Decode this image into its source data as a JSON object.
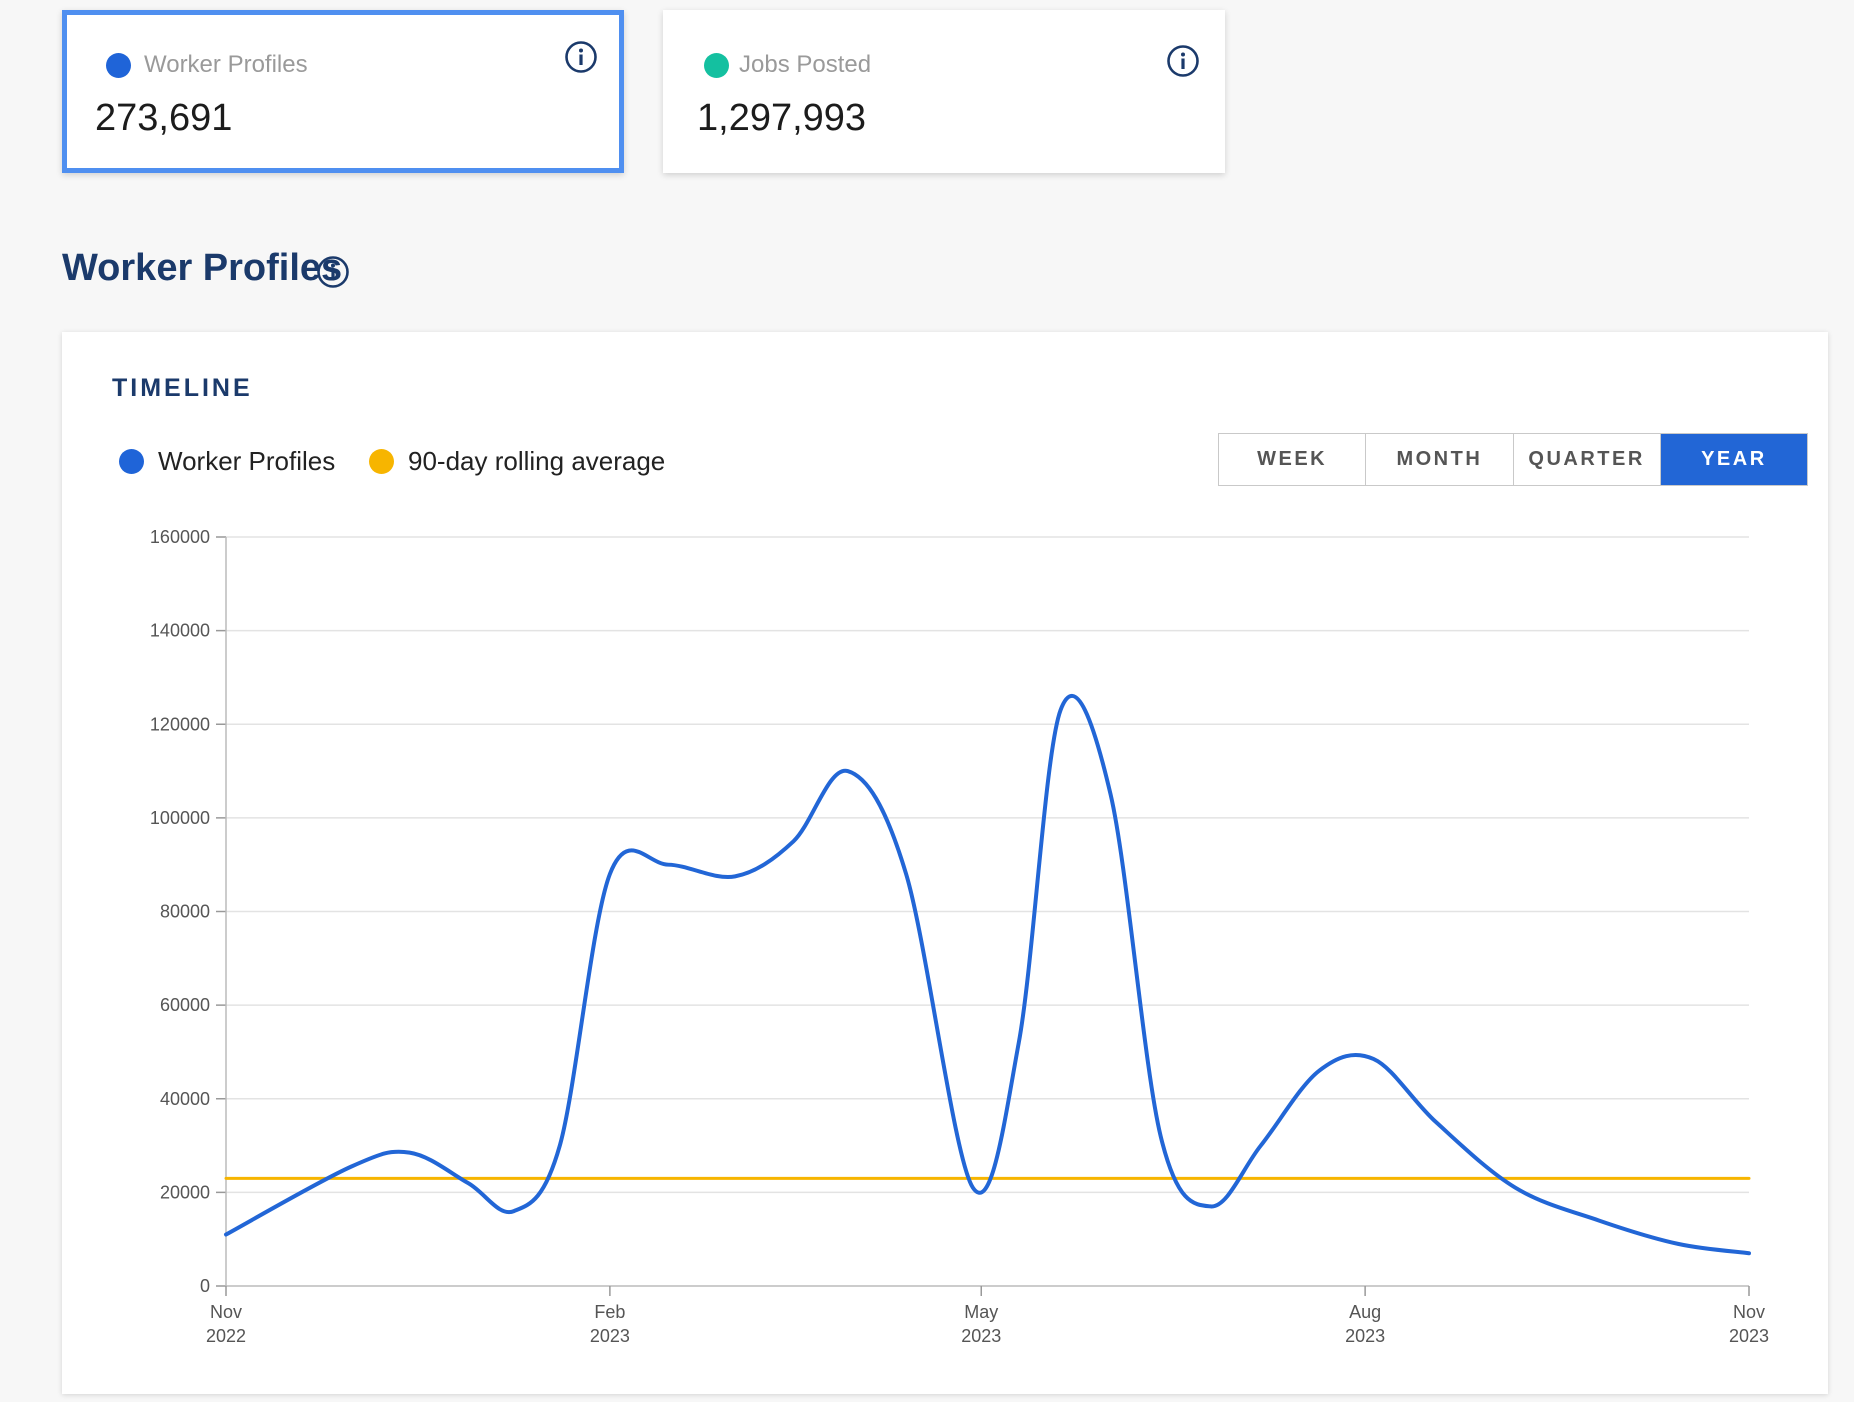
{
  "colors": {
    "accent_blue": "#2266d6",
    "worker_dot": "#1f64d8",
    "jobs_dot": "#14c0a0",
    "rolling_avg": "#f7b500",
    "selected_border": "#4f8ff0",
    "heading": "#1b3a6b"
  },
  "stat_cards": [
    {
      "label": "Worker Profiles",
      "value": "273,691",
      "selected": true,
      "icon": "info-icon"
    },
    {
      "label": "Jobs Posted",
      "value": "1,297,993",
      "selected": false,
      "icon": "info-icon"
    }
  ],
  "section": {
    "title": "Worker Profiles",
    "icon": "info-icon"
  },
  "timeline": {
    "title": "TIMELINE",
    "legend": [
      {
        "label": "Worker Profiles",
        "color": "#1f64d8"
      },
      {
        "label": "90-day rolling average",
        "color": "#f7b500"
      }
    ],
    "ranges": [
      "WEEK",
      "MONTH",
      "QUARTER",
      "YEAR"
    ],
    "active_range": "YEAR"
  },
  "chart_data": {
    "type": "line",
    "title": "",
    "xlabel": "",
    "ylabel": "",
    "x_ticks": [
      {
        "date": "2022-11",
        "line1": "Nov",
        "line2": "2022"
      },
      {
        "date": "2023-02",
        "line1": "Feb",
        "line2": "2023"
      },
      {
        "date": "2023-05",
        "line1": "May",
        "line2": "2023"
      },
      {
        "date": "2023-08",
        "line1": "Aug",
        "line2": "2023"
      },
      {
        "date": "2023-11",
        "line1": "Nov",
        "line2": "2023"
      }
    ],
    "xlim": [
      "2022-11",
      "2023-11"
    ],
    "ylim": [
      0,
      160000
    ],
    "y_ticks": [
      0,
      20000,
      40000,
      60000,
      80000,
      100000,
      120000,
      140000,
      160000
    ],
    "grid": true,
    "legend_position": "top-left",
    "series": [
      {
        "name": "Worker Profiles",
        "color": "#2266d6",
        "points": [
          {
            "x": "2022-11",
            "y": 11000
          },
          {
            "x": "2022-12-01",
            "y": 25500
          },
          {
            "x": "2022-12-15",
            "y": 28500
          },
          {
            "x": "2022-12-29",
            "y": 22000
          },
          {
            "x": "2023-01-09",
            "y": 16000
          },
          {
            "x": "2023-01-20",
            "y": 30000
          },
          {
            "x": "2023-02-01",
            "y": 88000
          },
          {
            "x": "2023-02-15",
            "y": 90000
          },
          {
            "x": "2023-03-03",
            "y": 87500
          },
          {
            "x": "2023-03-17",
            "y": 95000
          },
          {
            "x": "2023-03-30",
            "y": 110000
          },
          {
            "x": "2023-04-13",
            "y": 88000
          },
          {
            "x": "2023-04-29",
            "y": 21000
          },
          {
            "x": "2023-05-10",
            "y": 52000
          },
          {
            "x": "2023-05-20",
            "y": 123000
          },
          {
            "x": "2023-06-01",
            "y": 105000
          },
          {
            "x": "2023-06-13",
            "y": 32000
          },
          {
            "x": "2023-06-25",
            "y": 17000
          },
          {
            "x": "2023-07-07",
            "y": 30000
          },
          {
            "x": "2023-07-21",
            "y": 46000
          },
          {
            "x": "2023-08-03",
            "y": 48500
          },
          {
            "x": "2023-08-18",
            "y": 35000
          },
          {
            "x": "2023-09-06",
            "y": 21000
          },
          {
            "x": "2023-09-26",
            "y": 14000
          },
          {
            "x": "2023-10-15",
            "y": 9000
          },
          {
            "x": "2023-11-01",
            "y": 7000
          }
        ]
      },
      {
        "name": "90-day rolling average",
        "color": "#f7b500",
        "points": [
          {
            "x": "2022-11",
            "y": 23000
          },
          {
            "x": "2023-11",
            "y": 23000
          }
        ]
      }
    ]
  }
}
